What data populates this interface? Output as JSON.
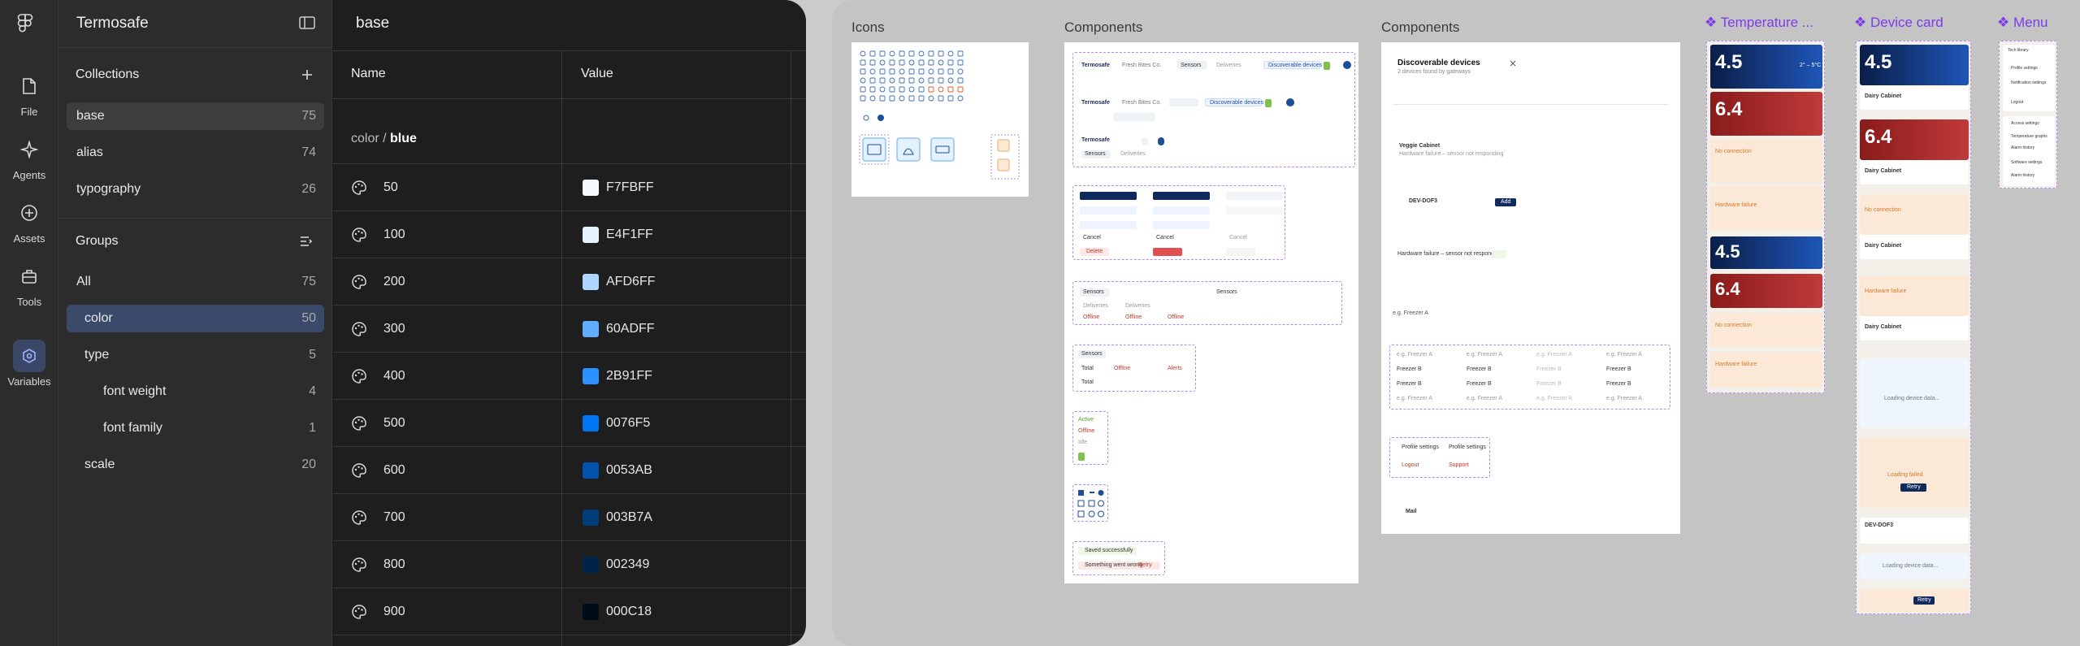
{
  "rail": {
    "items": [
      {
        "label": "File",
        "icon": "file-icon"
      },
      {
        "label": "Agents",
        "icon": "sparkle-icon"
      },
      {
        "label": "Assets",
        "icon": "plus-circle-icon"
      },
      {
        "label": "Tools",
        "icon": "toolbox-icon"
      },
      {
        "label": "Variables",
        "icon": "variables-icon"
      }
    ]
  },
  "file_name": "Termosafe",
  "collections": {
    "title": "Collections",
    "items": [
      {
        "label": "base",
        "count": "75"
      },
      {
        "label": "alias",
        "count": "74"
      },
      {
        "label": "typography",
        "count": "26"
      }
    ]
  },
  "groups": {
    "title": "Groups",
    "items": [
      {
        "label": "All",
        "count": "75"
      },
      {
        "label": "color",
        "count": "50"
      },
      {
        "label": "type",
        "count": "5"
      },
      {
        "label": "font weight",
        "count": "4"
      },
      {
        "label": "font family",
        "count": "1"
      },
      {
        "label": "scale",
        "count": "20"
      }
    ]
  },
  "table": {
    "title": "base",
    "col_name": "Name",
    "col_value": "Value",
    "group_path_prefix": "color / ",
    "group_path_current": "blue",
    "rows": [
      {
        "name": "50",
        "hex": "F7FBFF",
        "color": "#F7FBFF"
      },
      {
        "name": "100",
        "hex": "E4F1FF",
        "color": "#E4F1FF"
      },
      {
        "name": "200",
        "hex": "AFD6FF",
        "color": "#AFD6FF"
      },
      {
        "name": "300",
        "hex": "60ADFF",
        "color": "#60ADFF"
      },
      {
        "name": "400",
        "hex": "2B91FF",
        "color": "#2B91FF"
      },
      {
        "name": "500",
        "hex": "0076F5",
        "color": "#0076F5"
      },
      {
        "name": "600",
        "hex": "0053AB",
        "color": "#0053AB"
      },
      {
        "name": "700",
        "hex": "003B7A",
        "color": "#003B7A"
      },
      {
        "name": "800",
        "hex": "002349",
        "color": "#002349"
      },
      {
        "name": "900",
        "hex": "000C18",
        "color": "#000C18"
      }
    ]
  },
  "canvas": {
    "frames": {
      "icons": "Icons",
      "components_1": "Components",
      "components_2": "Components",
      "temperature": "Temperature ...",
      "device_card": "Device card",
      "menu": "Menu"
    },
    "mock": {
      "brand": "Termosafe",
      "company": "Fresh Bites Co.",
      "sensors": "Sensors",
      "deliveries": "Deliveries",
      "discoverable": "Discoverable devices",
      "discoverable_sub": "2 devices found by gateways",
      "cancel": "Cancel",
      "delete": "Delete",
      "offline": "Offline",
      "total": "Total",
      "alerts": "Alerts",
      "active": "Active",
      "idle": "Idle",
      "saved": "Saved successfully",
      "error": "Something went wrong",
      "retry": "Retry",
      "veggie": "Veggie Cabinet",
      "dev_id": "DEV-DOF3",
      "add": "Add",
      "hw_failure_row": "Hardware failure – sensor not responding",
      "preset": "e.g. Freezer A",
      "preset_b": "Freezer B",
      "profile": "Profile settings",
      "logout": "Logout",
      "support": "Support",
      "mail": "Mail",
      "temp_1": "4.5",
      "temp_2": "6.4",
      "unit": "°C",
      "range": "2° – 5°C",
      "no_conn": "No connection",
      "hw_failure": "Hardware failure",
      "dairy": "Dairy Cabinet",
      "loading": "Loading device data...",
      "loading_failed": "Loading failed",
      "menu_items": [
        "Tech library",
        "Profile settings",
        "Notification settings",
        "Logout",
        "Access settings",
        "Temperature graphs",
        "Alarm history",
        "Software settings",
        "Alarm history"
      ]
    }
  }
}
